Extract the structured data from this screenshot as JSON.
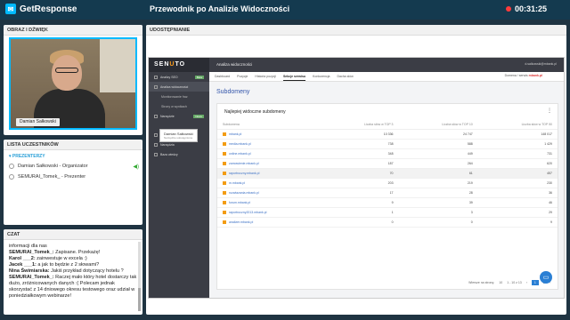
{
  "app": {
    "brand": "GetResponse",
    "title": "Przewodnik po Analizie Widoczności",
    "timer": "00:31:25"
  },
  "video": {
    "header": "OBRAZ I DŹWIĘK",
    "presenter_name": "Damian Sałkowski"
  },
  "participants": {
    "header": "LISTA UCZESTNIKÓW",
    "group": "PREZENTERZY",
    "items": [
      {
        "label": "Damian Sałkowski - Organizator"
      },
      {
        "label": "SEMURAI_Tomek_ - Prezenter"
      }
    ]
  },
  "chat": {
    "header": "CZAT",
    "messages": [
      {
        "author": "",
        "text": "informacji dla nas"
      },
      {
        "author": "SEMURAI_Tomek_:",
        "text": " Zapisane. Przekażę!"
      },
      {
        "author": "Karol ___2:",
        "text": " zainwestuje w excela :)"
      },
      {
        "author": "Jacek ___1:",
        "text": " a jak to będzie z 2 słowami?"
      },
      {
        "author": "Nina Świmiarska:",
        "text": " Jakiś przykład dotyczący hotelu ?"
      },
      {
        "author": "SEMURAI_Tomek_:",
        "text": " Raczej mało który hotel dostarczy tak dużo, zróżnicowanych danych :( Polecam jednak skorzystać z 14 dniowego okresu testowego oraz udział w poniedziałkowym webinarze!"
      }
    ]
  },
  "share": {
    "header": "UDOSTĘPNIANIE",
    "brand": "SENUTO",
    "page_heading": "Analiza widoczności",
    "user": "d.salkowski@mbank.pl",
    "nav": [
      {
        "label": "Analizy SEO",
        "badge": "Beta"
      },
      {
        "label": "Analiza widoczności",
        "badge": ""
      },
      {
        "label": "Monitorowanie fraz",
        "badge": ""
      },
      {
        "label": "Strony w wynikach",
        "badge": ""
      },
      {
        "label": "Narzędzie",
        "badge": "Nowe"
      },
      {
        "label": "Baza słów kluczowych",
        "badge": ""
      },
      {
        "label": "Narzędzia",
        "badge": ""
      },
      {
        "label": "Baza wiedzy",
        "badge": ""
      }
    ],
    "cursor_label": "Damian Sałkowski",
    "cursor_sub": "Narzędzie udostępnione",
    "tabs": [
      "Dashboard",
      "Pozycje",
      "Historia pozycji",
      "Sekcje serwisu",
      "Konkurencja",
      "Dacha słów"
    ],
    "active_tab": 3,
    "domain_label": "Domena / serwis",
    "domain": "mbank.pl",
    "section_title": "Subdomeny",
    "card_title": "Najlepiej widoczne subdomeny",
    "columns": [
      "Subdomena",
      "Liczba słów w TOP 3",
      "Liczba słów w TOP 10",
      "Liczba słów w TOP 50"
    ],
    "rows": [
      {
        "domain": "mbank.pl",
        "top3": "10 336",
        "top10": "24 747",
        "top50": "148 017",
        "hl": false
      },
      {
        "domain": "media.mbank.pl",
        "top3": "738",
        "top10": "588",
        "top50": "1 429",
        "hl": false
      },
      {
        "domain": "online.mbank.pl",
        "top3": "348",
        "top10": "449",
        "top50": "731",
        "hl": false
      },
      {
        "domain": "zamowienie.mbank.pl",
        "top3": "187",
        "top10": "264",
        "top50": "620",
        "hl": false
      },
      {
        "domain": "raportroczny.mbank.pl",
        "top3": "70",
        "top10": "61",
        "top50": "457",
        "hl": true
      },
      {
        "domain": "m.mbank.pl",
        "top3": "203",
        "top10": "219",
        "top50": "230",
        "hl": false
      },
      {
        "domain": "rozwiazania.mbank.pl",
        "top3": "17",
        "top10": "28",
        "top50": "36",
        "hl": false
      },
      {
        "domain": "forum.mbank.pl",
        "top3": "9",
        "top10": "39",
        "top50": "46",
        "hl": false
      },
      {
        "domain": "raportroczny2013.mbank.pl",
        "top3": "1",
        "top10": "3",
        "top50": "29",
        "hl": false
      },
      {
        "domain": "analizer.mbank.pl",
        "top3": "0",
        "top10": "0",
        "top50": "9",
        "hl": false
      }
    ],
    "pager": {
      "rows_label": "Wiersze na stronę:",
      "rows": "10",
      "range": "1 - 10 z 13",
      "current": "1",
      "next": "2"
    }
  }
}
